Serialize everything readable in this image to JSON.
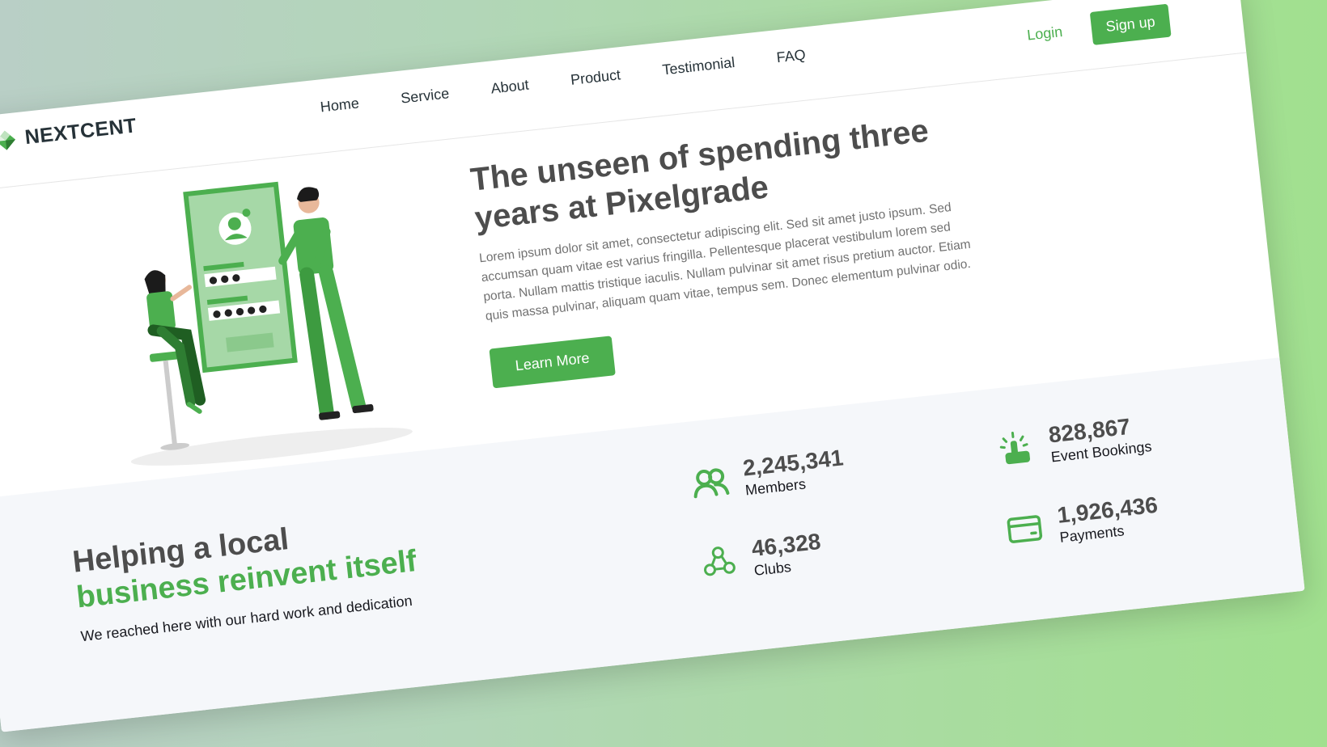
{
  "brand": {
    "name": "NEXTCENT"
  },
  "nav": {
    "items": [
      {
        "label": "Home"
      },
      {
        "label": "Service"
      },
      {
        "label": "About"
      },
      {
        "label": "Product"
      },
      {
        "label": "Testimonial"
      },
      {
        "label": "FAQ"
      }
    ],
    "login_label": "Login",
    "signup_label": "Sign up"
  },
  "hero": {
    "title": "The unseen of spending three years at Pixelgrade",
    "body": "Lorem ipsum dolor sit amet, consectetur adipiscing elit. Sed sit amet justo ipsum. Sed accumsan quam vitae est varius fringilla. Pellentesque placerat vestibulum lorem sed porta. Nullam mattis tristique iaculis. Nullam pulvinar sit amet risus pretium auctor. Etiam quis massa pulvinar, aliquam quam vitae, tempus sem. Donec elementum pulvinar odio.",
    "cta_label": "Learn More"
  },
  "stats": {
    "title_line1": "Helping a local",
    "title_line2": "business reinvent itself",
    "subtitle": "We reached here with our hard work and dedication",
    "items": [
      {
        "value": "2,245,341",
        "label": "Members",
        "icon": "members-icon"
      },
      {
        "value": "46,328",
        "label": "Clubs",
        "icon": "clubs-icon"
      },
      {
        "value": "828,867",
        "label": "Event Bookings",
        "icon": "event-bookings-icon"
      },
      {
        "value": "1,926,436",
        "label": "Payments",
        "icon": "payments-icon"
      }
    ]
  },
  "colors": {
    "primary": "#4caf4f",
    "text_dark": "#4d4d4d",
    "stats_bg": "#f5f7fa"
  }
}
